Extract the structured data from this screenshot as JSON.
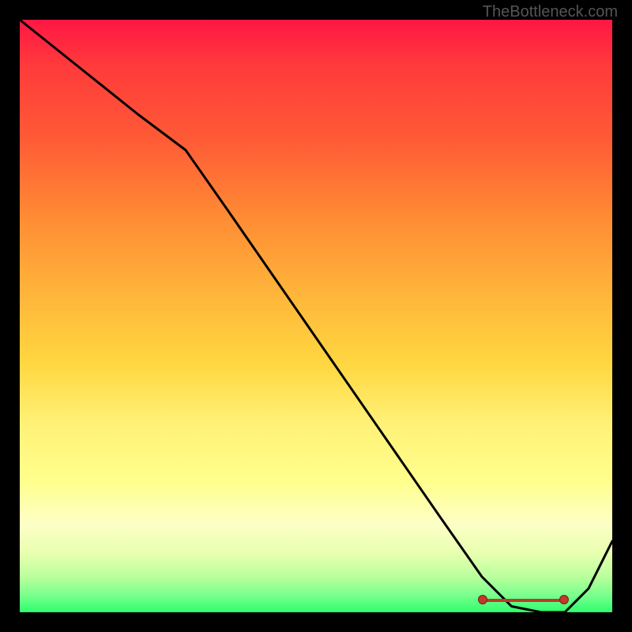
{
  "watermark": "TheBottleneck.com",
  "chart_data": {
    "type": "line",
    "title": "",
    "xlabel": "",
    "ylabel": "",
    "xlim": [
      0,
      100
    ],
    "ylim": [
      0,
      100
    ],
    "series": [
      {
        "name": "curve",
        "x": [
          0,
          10,
          20,
          28,
          35,
          44,
          53,
          62,
          71,
          78,
          83,
          88,
          92,
          96,
          100
        ],
        "y": [
          100,
          92,
          84,
          78,
          68,
          55,
          42,
          29,
          16,
          6,
          1,
          0,
          0,
          4,
          12
        ]
      }
    ],
    "highlight_range_x": [
      78,
      92
    ]
  },
  "colors": {
    "curve": "#000000",
    "highlight": "#c0392b",
    "background_top": "#ff1744",
    "background_bottom": "#2dff6e"
  }
}
